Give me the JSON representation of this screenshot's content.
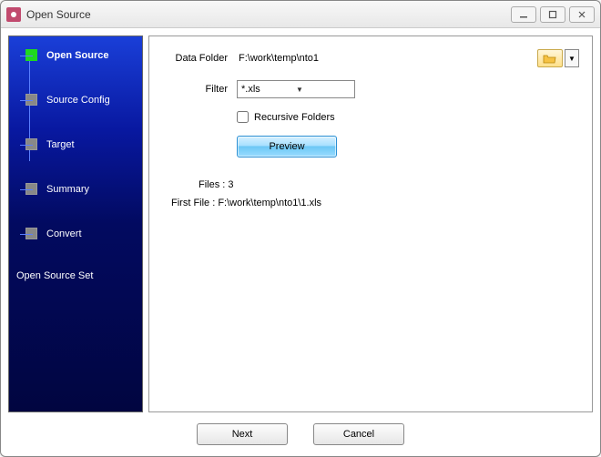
{
  "window": {
    "title": "Open Source"
  },
  "sidebar": {
    "items": [
      {
        "label": "Open Source",
        "active": true
      },
      {
        "label": "Source Config",
        "active": false
      },
      {
        "label": "Target",
        "active": false
      },
      {
        "label": "Summary",
        "active": false
      },
      {
        "label": "Convert",
        "active": false
      }
    ],
    "footer": "Open Source Set"
  },
  "main": {
    "data_folder_label": "Data Folder",
    "data_folder_value": "F:\\work\\temp\\nto1",
    "filter_label": "Filter",
    "filter_value": "*.xls",
    "recursive_label": "Recursive Folders",
    "recursive_checked": false,
    "preview_label": "Preview",
    "files_label": "Files : 3",
    "first_file_label": "First File : F:\\work\\temp\\nto1\\1.xls"
  },
  "footer": {
    "next_label": "Next",
    "cancel_label": "Cancel"
  }
}
